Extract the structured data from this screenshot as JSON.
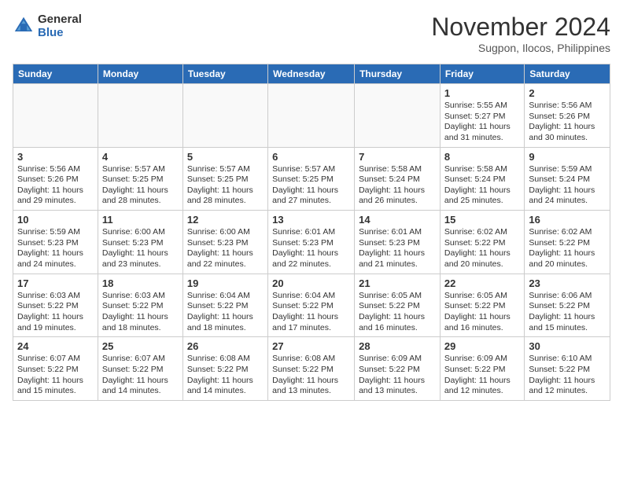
{
  "header": {
    "logo_general": "General",
    "logo_blue": "Blue",
    "month_title": "November 2024",
    "location": "Sugpon, Ilocos, Philippines"
  },
  "weekdays": [
    "Sunday",
    "Monday",
    "Tuesday",
    "Wednesday",
    "Thursday",
    "Friday",
    "Saturday"
  ],
  "weeks": [
    [
      {
        "day": "",
        "data": ""
      },
      {
        "day": "",
        "data": ""
      },
      {
        "day": "",
        "data": ""
      },
      {
        "day": "",
        "data": ""
      },
      {
        "day": "",
        "data": ""
      },
      {
        "day": "1",
        "data": "Sunrise: 5:55 AM\nSunset: 5:27 PM\nDaylight: 11 hours and 31 minutes."
      },
      {
        "day": "2",
        "data": "Sunrise: 5:56 AM\nSunset: 5:26 PM\nDaylight: 11 hours and 30 minutes."
      }
    ],
    [
      {
        "day": "3",
        "data": "Sunrise: 5:56 AM\nSunset: 5:26 PM\nDaylight: 11 hours and 29 minutes."
      },
      {
        "day": "4",
        "data": "Sunrise: 5:57 AM\nSunset: 5:25 PM\nDaylight: 11 hours and 28 minutes."
      },
      {
        "day": "5",
        "data": "Sunrise: 5:57 AM\nSunset: 5:25 PM\nDaylight: 11 hours and 28 minutes."
      },
      {
        "day": "6",
        "data": "Sunrise: 5:57 AM\nSunset: 5:25 PM\nDaylight: 11 hours and 27 minutes."
      },
      {
        "day": "7",
        "data": "Sunrise: 5:58 AM\nSunset: 5:24 PM\nDaylight: 11 hours and 26 minutes."
      },
      {
        "day": "8",
        "data": "Sunrise: 5:58 AM\nSunset: 5:24 PM\nDaylight: 11 hours and 25 minutes."
      },
      {
        "day": "9",
        "data": "Sunrise: 5:59 AM\nSunset: 5:24 PM\nDaylight: 11 hours and 24 minutes."
      }
    ],
    [
      {
        "day": "10",
        "data": "Sunrise: 5:59 AM\nSunset: 5:23 PM\nDaylight: 11 hours and 24 minutes."
      },
      {
        "day": "11",
        "data": "Sunrise: 6:00 AM\nSunset: 5:23 PM\nDaylight: 11 hours and 23 minutes."
      },
      {
        "day": "12",
        "data": "Sunrise: 6:00 AM\nSunset: 5:23 PM\nDaylight: 11 hours and 22 minutes."
      },
      {
        "day": "13",
        "data": "Sunrise: 6:01 AM\nSunset: 5:23 PM\nDaylight: 11 hours and 22 minutes."
      },
      {
        "day": "14",
        "data": "Sunrise: 6:01 AM\nSunset: 5:23 PM\nDaylight: 11 hours and 21 minutes."
      },
      {
        "day": "15",
        "data": "Sunrise: 6:02 AM\nSunset: 5:22 PM\nDaylight: 11 hours and 20 minutes."
      },
      {
        "day": "16",
        "data": "Sunrise: 6:02 AM\nSunset: 5:22 PM\nDaylight: 11 hours and 20 minutes."
      }
    ],
    [
      {
        "day": "17",
        "data": "Sunrise: 6:03 AM\nSunset: 5:22 PM\nDaylight: 11 hours and 19 minutes."
      },
      {
        "day": "18",
        "data": "Sunrise: 6:03 AM\nSunset: 5:22 PM\nDaylight: 11 hours and 18 minutes."
      },
      {
        "day": "19",
        "data": "Sunrise: 6:04 AM\nSunset: 5:22 PM\nDaylight: 11 hours and 18 minutes."
      },
      {
        "day": "20",
        "data": "Sunrise: 6:04 AM\nSunset: 5:22 PM\nDaylight: 11 hours and 17 minutes."
      },
      {
        "day": "21",
        "data": "Sunrise: 6:05 AM\nSunset: 5:22 PM\nDaylight: 11 hours and 16 minutes."
      },
      {
        "day": "22",
        "data": "Sunrise: 6:05 AM\nSunset: 5:22 PM\nDaylight: 11 hours and 16 minutes."
      },
      {
        "day": "23",
        "data": "Sunrise: 6:06 AM\nSunset: 5:22 PM\nDaylight: 11 hours and 15 minutes."
      }
    ],
    [
      {
        "day": "24",
        "data": "Sunrise: 6:07 AM\nSunset: 5:22 PM\nDaylight: 11 hours and 15 minutes."
      },
      {
        "day": "25",
        "data": "Sunrise: 6:07 AM\nSunset: 5:22 PM\nDaylight: 11 hours and 14 minutes."
      },
      {
        "day": "26",
        "data": "Sunrise: 6:08 AM\nSunset: 5:22 PM\nDaylight: 11 hours and 14 minutes."
      },
      {
        "day": "27",
        "data": "Sunrise: 6:08 AM\nSunset: 5:22 PM\nDaylight: 11 hours and 13 minutes."
      },
      {
        "day": "28",
        "data": "Sunrise: 6:09 AM\nSunset: 5:22 PM\nDaylight: 11 hours and 13 minutes."
      },
      {
        "day": "29",
        "data": "Sunrise: 6:09 AM\nSunset: 5:22 PM\nDaylight: 11 hours and 12 minutes."
      },
      {
        "day": "30",
        "data": "Sunrise: 6:10 AM\nSunset: 5:22 PM\nDaylight: 11 hours and 12 minutes."
      }
    ]
  ]
}
